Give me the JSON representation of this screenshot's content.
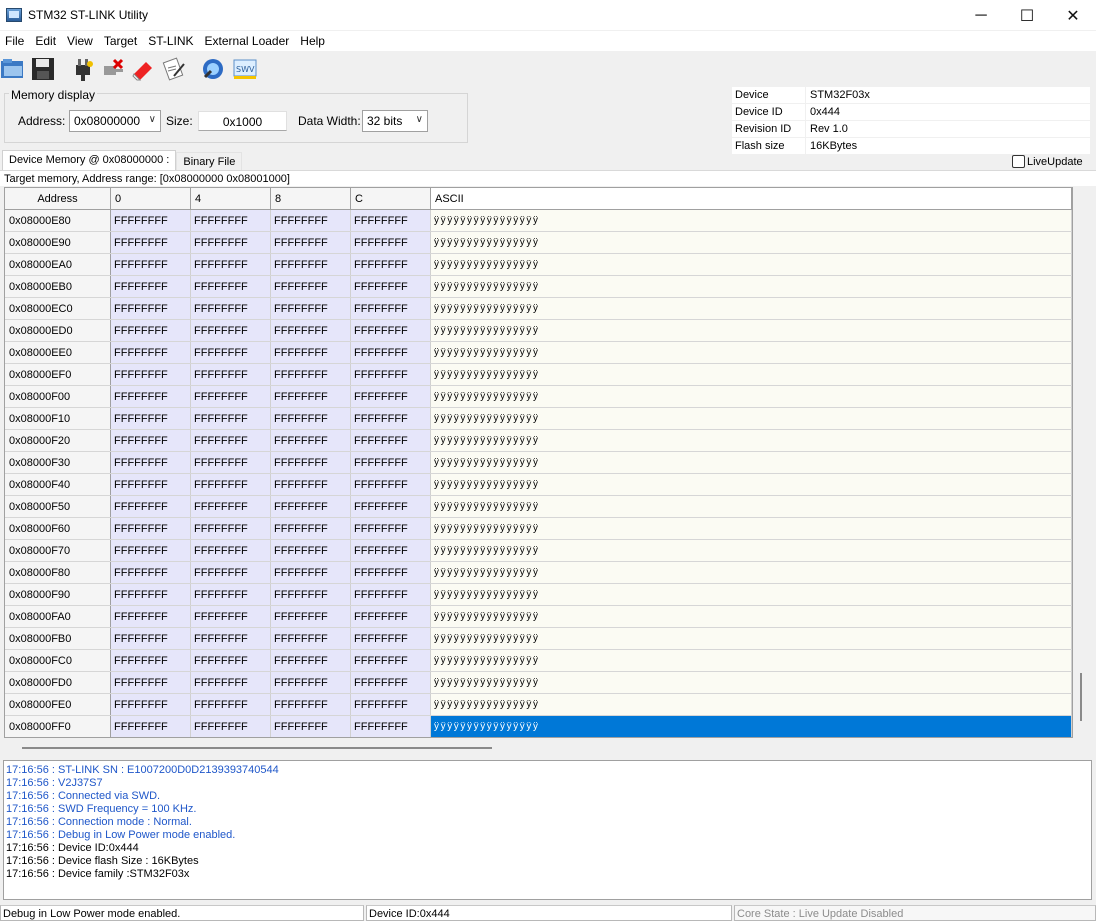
{
  "window": {
    "title": "STM32 ST-LINK Utility",
    "controls": {
      "minimize": "─",
      "maximize": "☐",
      "close": "✕"
    }
  },
  "menu": [
    "File",
    "Edit",
    "View",
    "Target",
    "ST-LINK",
    "External Loader",
    "Help"
  ],
  "toolbar": {
    "icons": [
      "open-file-icon",
      "save-icon",
      "connect-icon",
      "disconnect-icon",
      "erase-chip-icon",
      "program-verify-icon",
      "mcu-core-icon",
      "swv-icon"
    ]
  },
  "memory_display": {
    "legend": "Memory display",
    "address_label": "Address:",
    "address_value": "0x08000000",
    "size_label": "Size:",
    "size_value": "0x1000",
    "width_label": "Data Width:",
    "width_value": "32 bits"
  },
  "device_info": [
    {
      "key": "Device",
      "value": "STM32F03x"
    },
    {
      "key": "Device ID",
      "value": "0x444"
    },
    {
      "key": "Revision ID",
      "value": "Rev 1.0"
    },
    {
      "key": "Flash size",
      "value": "16KBytes"
    }
  ],
  "live_update_label": "LiveUpdate",
  "tabs": [
    "Device Memory @ 0x08000000 :",
    "Binary File"
  ],
  "range_text": "Target memory, Address range: [0x08000000 0x08001000]",
  "grid": {
    "headers": [
      "Address",
      "0",
      "4",
      "8",
      "C",
      "ASCII"
    ],
    "rows": [
      {
        "addr": "0x08000E80",
        "c0": "FFFFFFFF",
        "c4": "FFFFFFFF",
        "c8": "FFFFFFFF",
        "cC": "FFFFFFFF",
        "ascii": "ÿÿÿÿÿÿÿÿÿÿÿÿÿÿÿÿ"
      },
      {
        "addr": "0x08000E90",
        "c0": "FFFFFFFF",
        "c4": "FFFFFFFF",
        "c8": "FFFFFFFF",
        "cC": "FFFFFFFF",
        "ascii": "ÿÿÿÿÿÿÿÿÿÿÿÿÿÿÿÿ"
      },
      {
        "addr": "0x08000EA0",
        "c0": "FFFFFFFF",
        "c4": "FFFFFFFF",
        "c8": "FFFFFFFF",
        "cC": "FFFFFFFF",
        "ascii": "ÿÿÿÿÿÿÿÿÿÿÿÿÿÿÿÿ"
      },
      {
        "addr": "0x08000EB0",
        "c0": "FFFFFFFF",
        "c4": "FFFFFFFF",
        "c8": "FFFFFFFF",
        "cC": "FFFFFFFF",
        "ascii": "ÿÿÿÿÿÿÿÿÿÿÿÿÿÿÿÿ"
      },
      {
        "addr": "0x08000EC0",
        "c0": "FFFFFFFF",
        "c4": "FFFFFFFF",
        "c8": "FFFFFFFF",
        "cC": "FFFFFFFF",
        "ascii": "ÿÿÿÿÿÿÿÿÿÿÿÿÿÿÿÿ"
      },
      {
        "addr": "0x08000ED0",
        "c0": "FFFFFFFF",
        "c4": "FFFFFFFF",
        "c8": "FFFFFFFF",
        "cC": "FFFFFFFF",
        "ascii": "ÿÿÿÿÿÿÿÿÿÿÿÿÿÿÿÿ"
      },
      {
        "addr": "0x08000EE0",
        "c0": "FFFFFFFF",
        "c4": "FFFFFFFF",
        "c8": "FFFFFFFF",
        "cC": "FFFFFFFF",
        "ascii": "ÿÿÿÿÿÿÿÿÿÿÿÿÿÿÿÿ"
      },
      {
        "addr": "0x08000EF0",
        "c0": "FFFFFFFF",
        "c4": "FFFFFFFF",
        "c8": "FFFFFFFF",
        "cC": "FFFFFFFF",
        "ascii": "ÿÿÿÿÿÿÿÿÿÿÿÿÿÿÿÿ"
      },
      {
        "addr": "0x08000F00",
        "c0": "FFFFFFFF",
        "c4": "FFFFFFFF",
        "c8": "FFFFFFFF",
        "cC": "FFFFFFFF",
        "ascii": "ÿÿÿÿÿÿÿÿÿÿÿÿÿÿÿÿ"
      },
      {
        "addr": "0x08000F10",
        "c0": "FFFFFFFF",
        "c4": "FFFFFFFF",
        "c8": "FFFFFFFF",
        "cC": "FFFFFFFF",
        "ascii": "ÿÿÿÿÿÿÿÿÿÿÿÿÿÿÿÿ"
      },
      {
        "addr": "0x08000F20",
        "c0": "FFFFFFFF",
        "c4": "FFFFFFFF",
        "c8": "FFFFFFFF",
        "cC": "FFFFFFFF",
        "ascii": "ÿÿÿÿÿÿÿÿÿÿÿÿÿÿÿÿ"
      },
      {
        "addr": "0x08000F30",
        "c0": "FFFFFFFF",
        "c4": "FFFFFFFF",
        "c8": "FFFFFFFF",
        "cC": "FFFFFFFF",
        "ascii": "ÿÿÿÿÿÿÿÿÿÿÿÿÿÿÿÿ"
      },
      {
        "addr": "0x08000F40",
        "c0": "FFFFFFFF",
        "c4": "FFFFFFFF",
        "c8": "FFFFFFFF",
        "cC": "FFFFFFFF",
        "ascii": "ÿÿÿÿÿÿÿÿÿÿÿÿÿÿÿÿ"
      },
      {
        "addr": "0x08000F50",
        "c0": "FFFFFFFF",
        "c4": "FFFFFFFF",
        "c8": "FFFFFFFF",
        "cC": "FFFFFFFF",
        "ascii": "ÿÿÿÿÿÿÿÿÿÿÿÿÿÿÿÿ"
      },
      {
        "addr": "0x08000F60",
        "c0": "FFFFFFFF",
        "c4": "FFFFFFFF",
        "c8": "FFFFFFFF",
        "cC": "FFFFFFFF",
        "ascii": "ÿÿÿÿÿÿÿÿÿÿÿÿÿÿÿÿ"
      },
      {
        "addr": "0x08000F70",
        "c0": "FFFFFFFF",
        "c4": "FFFFFFFF",
        "c8": "FFFFFFFF",
        "cC": "FFFFFFFF",
        "ascii": "ÿÿÿÿÿÿÿÿÿÿÿÿÿÿÿÿ"
      },
      {
        "addr": "0x08000F80",
        "c0": "FFFFFFFF",
        "c4": "FFFFFFFF",
        "c8": "FFFFFFFF",
        "cC": "FFFFFFFF",
        "ascii": "ÿÿÿÿÿÿÿÿÿÿÿÿÿÿÿÿ"
      },
      {
        "addr": "0x08000F90",
        "c0": "FFFFFFFF",
        "c4": "FFFFFFFF",
        "c8": "FFFFFFFF",
        "cC": "FFFFFFFF",
        "ascii": "ÿÿÿÿÿÿÿÿÿÿÿÿÿÿÿÿ"
      },
      {
        "addr": "0x08000FA0",
        "c0": "FFFFFFFF",
        "c4": "FFFFFFFF",
        "c8": "FFFFFFFF",
        "cC": "FFFFFFFF",
        "ascii": "ÿÿÿÿÿÿÿÿÿÿÿÿÿÿÿÿ"
      },
      {
        "addr": "0x08000FB0",
        "c0": "FFFFFFFF",
        "c4": "FFFFFFFF",
        "c8": "FFFFFFFF",
        "cC": "FFFFFFFF",
        "ascii": "ÿÿÿÿÿÿÿÿÿÿÿÿÿÿÿÿ"
      },
      {
        "addr": "0x08000FC0",
        "c0": "FFFFFFFF",
        "c4": "FFFFFFFF",
        "c8": "FFFFFFFF",
        "cC": "FFFFFFFF",
        "ascii": "ÿÿÿÿÿÿÿÿÿÿÿÿÿÿÿÿ"
      },
      {
        "addr": "0x08000FD0",
        "c0": "FFFFFFFF",
        "c4": "FFFFFFFF",
        "c8": "FFFFFFFF",
        "cC": "FFFFFFFF",
        "ascii": "ÿÿÿÿÿÿÿÿÿÿÿÿÿÿÿÿ"
      },
      {
        "addr": "0x08000FE0",
        "c0": "FFFFFFFF",
        "c4": "FFFFFFFF",
        "c8": "FFFFFFFF",
        "cC": "FFFFFFFF",
        "ascii": "ÿÿÿÿÿÿÿÿÿÿÿÿÿÿÿÿ"
      },
      {
        "addr": "0x08000FF0",
        "c0": "FFFFFFFF",
        "c4": "FFFFFFFF",
        "c8": "FFFFFFFF",
        "cC": "FFFFFFFF",
        "ascii": "ÿÿÿÿÿÿÿÿÿÿÿÿÿÿÿÿ",
        "selected": true
      }
    ]
  },
  "log": [
    {
      "text": "17:16:56 : ST-LINK SN : E1007200D0D2139393740544",
      "color": "blue"
    },
    {
      "text": "17:16:56 : V2J37S7",
      "color": "blue"
    },
    {
      "text": "17:16:56 : Connected via SWD.",
      "color": "blue"
    },
    {
      "text": "17:16:56 : SWD Frequency = 100 KHz.",
      "color": "blue"
    },
    {
      "text": "17:16:56 : Connection mode : Normal.",
      "color": "blue"
    },
    {
      "text": "17:16:56 : Debug in Low Power mode enabled.",
      "color": "blue"
    },
    {
      "text": "17:16:56 : Device ID:0x444",
      "color": "black"
    },
    {
      "text": "17:16:56 : Device flash Size : 16KBytes",
      "color": "black"
    },
    {
      "text": "17:16:56 : Device family :STM32F03x",
      "color": "black"
    }
  ],
  "status": {
    "left": "Debug in Low Power mode enabled.",
    "middle": "Device ID:0x444",
    "right": "Core State : Live Update Disabled"
  },
  "colors": {
    "log_blue": "#1f57c9",
    "selection": "#0078d7",
    "value_cell_bg": "#e6e6fa",
    "ascii_cell_bg": "#fbfbf3"
  }
}
